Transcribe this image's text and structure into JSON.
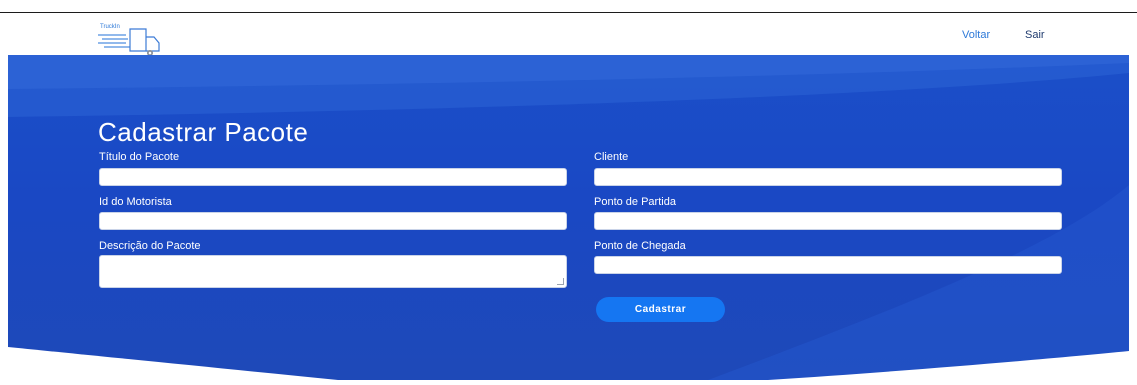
{
  "navbar": {
    "logo_text": "TruckIn",
    "links": [
      "Voltar",
      "Sair"
    ]
  },
  "colors": {
    "hero_blue": "#1b4fc9",
    "button_blue": "#1576f2",
    "nav_link": "#2d79d8"
  },
  "form": {
    "title": "Cadastrar Pacote",
    "fields": {
      "titulo": {
        "label": "Título do Pacote",
        "value": ""
      },
      "motorista": {
        "label": "Id do Motorista",
        "value": ""
      },
      "descricao": {
        "label": "Descrição do Pacote",
        "value": ""
      },
      "cliente": {
        "label": "Cliente",
        "value": ""
      },
      "partida": {
        "label": "Ponto de Partida",
        "value": ""
      },
      "chegada": {
        "label": "Ponto de Chegada",
        "value": ""
      }
    },
    "submit_label": "Cadastrar"
  }
}
